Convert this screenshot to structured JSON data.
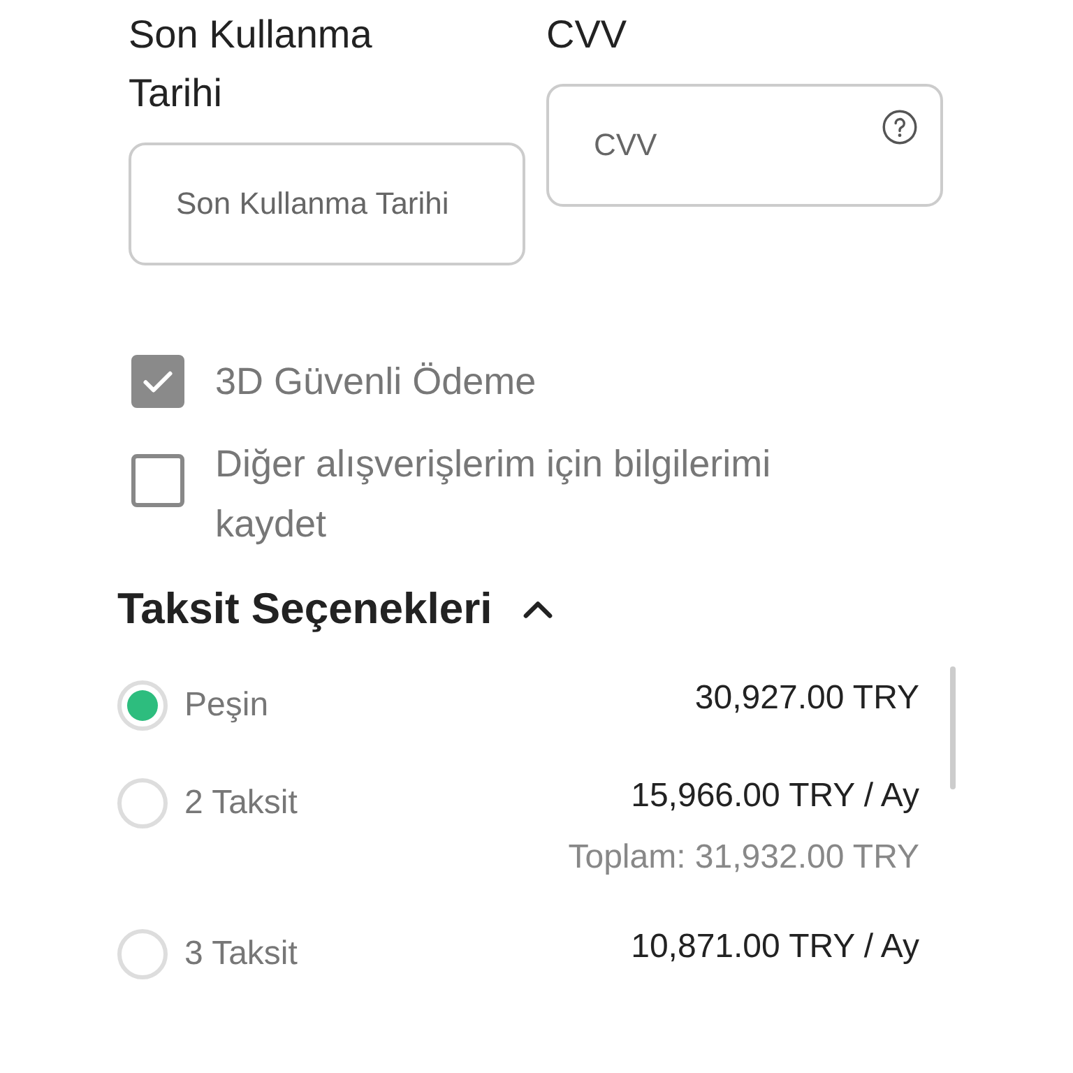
{
  "card_fields": [
    {
      "label": "Son Kullanma Tarihi",
      "placeholder": "Son Kullanma Tarihi",
      "help": false
    },
    {
      "label": "CVV",
      "placeholder": "CVV",
      "help": true
    }
  ],
  "options": [
    {
      "label": "3D Güvenli Ödeme",
      "checked": true
    },
    {
      "label": "Diğer alışverişlerim için bilgilerimi kaydet",
      "checked": false
    }
  ],
  "installments": {
    "title": "Taksit Seçenekleri",
    "expanded": true,
    "items": [
      {
        "label": "Peşin",
        "amount": "30,927.00 TRY",
        "selected": true
      },
      {
        "label": "2 Taksit",
        "amount": "15,966.00 TRY / Ay",
        "total": "Toplam: 31,932.00 TRY",
        "selected": false
      },
      {
        "label": "3 Taksit",
        "amount": "10,871.00 TRY / Ay",
        "selected": false
      }
    ]
  }
}
